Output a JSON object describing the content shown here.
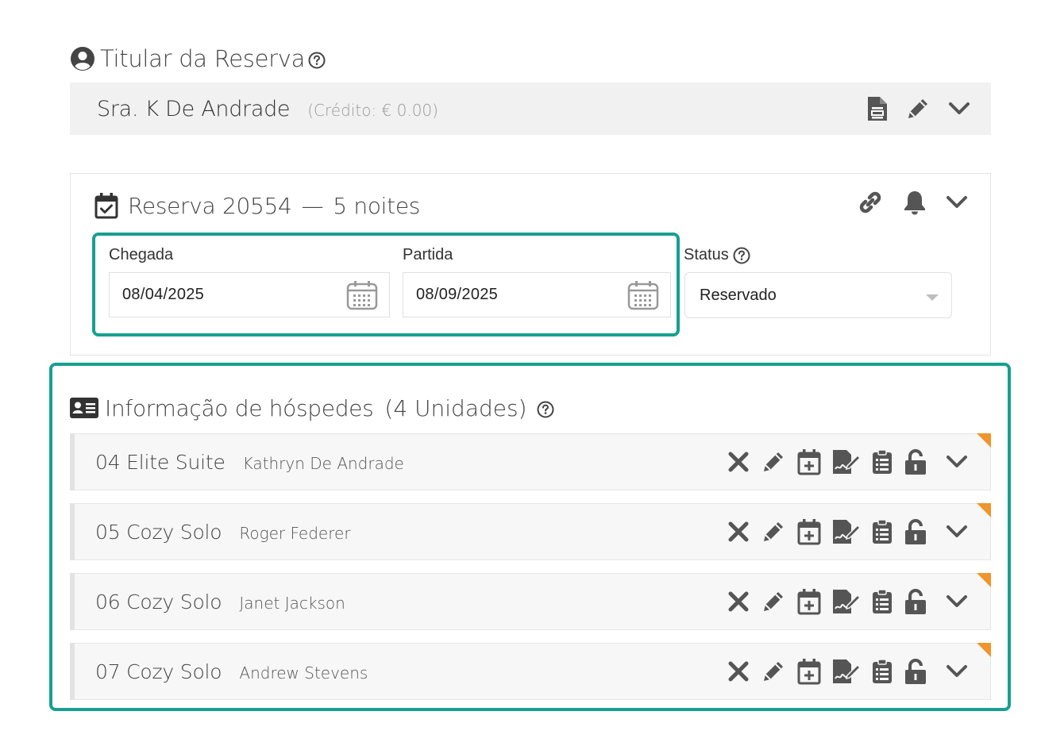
{
  "titular": {
    "heading": "Titular da Reserva",
    "name": "Sra. K De Andrade",
    "credit": "(Crédito: € 0.00)"
  },
  "reservation": {
    "title": "Reserva 20554",
    "dash": "—",
    "nights": "5 noites",
    "arrival_label": "Chegada",
    "arrival_value": "08/04/2025",
    "departure_label": "Partida",
    "departure_value": "08/09/2025",
    "status_label": "Status",
    "status_value": "Reservado"
  },
  "guests": {
    "heading": "Informação de hóspedes",
    "count": "(4 Unidades)",
    "units": [
      {
        "unit": "04 Elite Suite",
        "guest": "Kathryn De Andrade"
      },
      {
        "unit": "05 Cozy Solo",
        "guest": "Roger Federer"
      },
      {
        "unit": "06 Cozy Solo",
        "guest": "Janet Jackson"
      },
      {
        "unit": "07 Cozy Solo",
        "guest": "Andrew Stevens"
      }
    ]
  },
  "colors": {
    "highlight": "#16a08f",
    "corner_flag": "#f0952b",
    "icon": "#555555"
  }
}
